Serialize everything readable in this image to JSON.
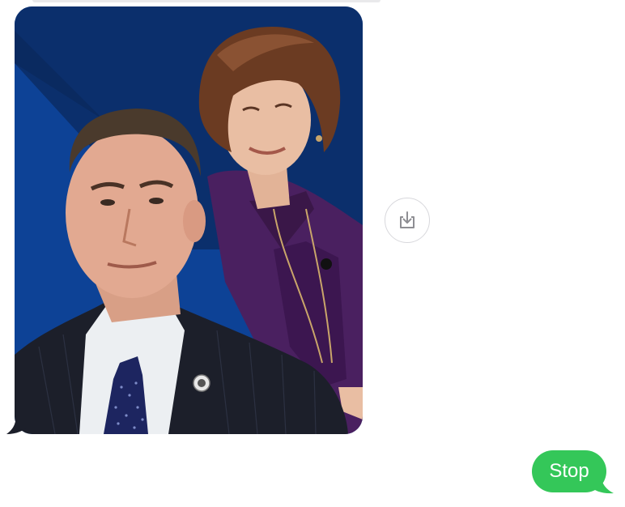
{
  "conversation": {
    "incoming_image": {
      "kind": "photo",
      "background_color": "#0c3f8e",
      "background_dark_color": "#0b2a63"
    },
    "save_button": {
      "icon": "download-tray-icon"
    },
    "outgoing_message": {
      "text": "Stop",
      "bubble_color": "#34c759",
      "text_color": "#ffffff"
    },
    "incoming_bubble_color": "#e9e9eb"
  }
}
